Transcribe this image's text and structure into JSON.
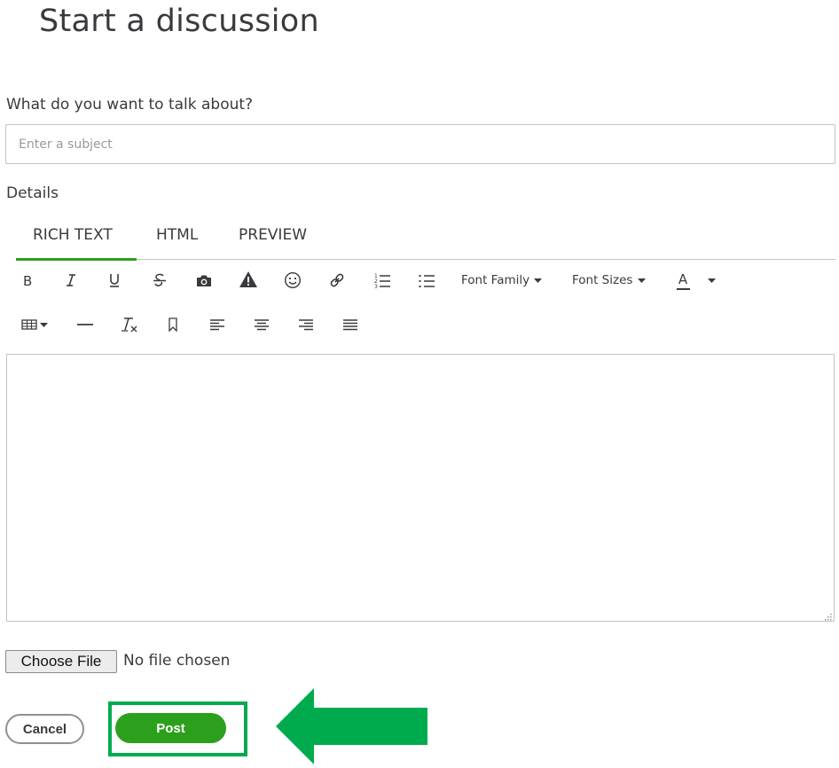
{
  "page": {
    "title": "Start a discussion"
  },
  "subject": {
    "label": "What do you want to talk about?",
    "placeholder": "Enter a subject",
    "value": ""
  },
  "details": {
    "label": "Details"
  },
  "tabs": [
    {
      "label": "RICH TEXT",
      "active": true
    },
    {
      "label": "HTML",
      "active": false
    },
    {
      "label": "PREVIEW",
      "active": false
    }
  ],
  "toolbar": {
    "row1": [
      "bold-icon",
      "italic-icon",
      "underline-icon",
      "strikethrough-icon",
      "camera-icon",
      "warning-icon",
      "emoji-icon",
      "link-icon",
      "numbered-list-icon",
      "bulleted-list-icon"
    ],
    "font_family_label": "Font Family",
    "font_sizes_label": "Font Sizes",
    "text_color_label": "A",
    "row2": [
      "table-icon",
      "horizontal-rule-icon",
      "clear-formatting-icon",
      "bookmark-icon",
      "align-left-icon",
      "align-center-icon",
      "align-right-icon",
      "justify-icon"
    ]
  },
  "file": {
    "button_label": "Choose File",
    "status": "No file chosen"
  },
  "actions": {
    "cancel_label": "Cancel",
    "post_label": "Post"
  },
  "colors": {
    "accent": "#2ca01c",
    "highlight": "#00ab4e",
    "text": "#393a3d",
    "border": "#c4c4c4"
  }
}
